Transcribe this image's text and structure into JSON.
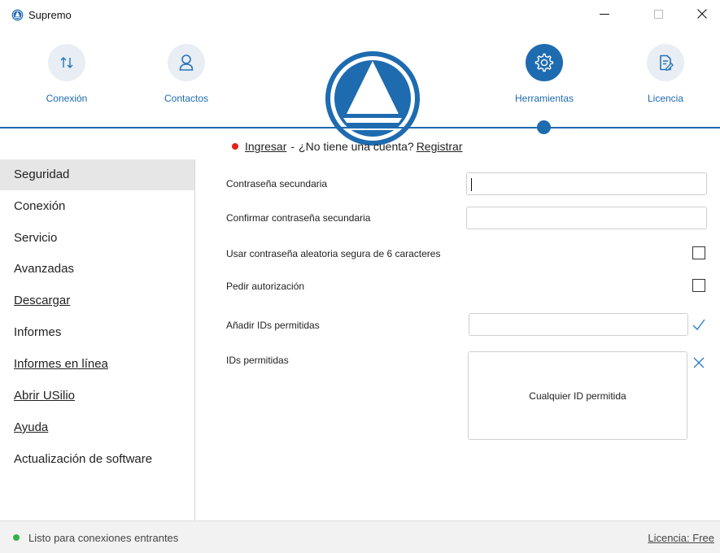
{
  "window": {
    "title": "Supremo",
    "controls": [
      "minimize",
      "maximize",
      "close"
    ]
  },
  "nav": {
    "items": [
      {
        "label": "Conexión",
        "icon": "transfer-arrows-icon",
        "active": false
      },
      {
        "label": "Contactos",
        "icon": "user-icon",
        "active": false
      },
      {
        "label": "Herramientas",
        "icon": "gear-icon",
        "active": true
      },
      {
        "label": "Licencia",
        "icon": "document-edit-icon",
        "active": false
      }
    ],
    "logo": "supremo-logo",
    "accent_color": "#1e6bb0"
  },
  "login": {
    "login_link": "Ingresar",
    "separator": "-",
    "question": "¿No tiene una cuenta?",
    "register_link": "Registrar",
    "status_color": "#e5201b"
  },
  "sidebar": {
    "items": [
      {
        "label": "Seguridad",
        "selected": true
      },
      {
        "label": "Conexión"
      },
      {
        "label": "Servicio"
      },
      {
        "label": "Avanzadas"
      },
      {
        "label": "Descargar",
        "link": true
      },
      {
        "label": "Informes"
      },
      {
        "label": "Informes en línea",
        "link": true
      },
      {
        "label": "Abrir USilio",
        "link": true
      },
      {
        "label": "Ayuda",
        "link": true
      },
      {
        "label": "Actualización de software"
      }
    ]
  },
  "security": {
    "secondary_password_label": "Contraseña secundaria",
    "secondary_password_value": "",
    "confirm_password_label": "Confirmar contraseña secundaria",
    "confirm_password_value": "",
    "random_password_label": "Usar contraseña aleatoria segura de 6 caracteres",
    "random_password_checked": false,
    "ask_authorization_label": "Pedir autorización",
    "ask_authorization_checked": false,
    "add_ids_label": "Añadir IDs permitidas",
    "add_ids_value": "",
    "allowed_ids_label": "IDs permitidas",
    "allowed_ids_empty_text": "Cualquier ID permitida"
  },
  "statusbar": {
    "status_text": "Listo para conexiones entrantes",
    "status_color": "#33b14a",
    "license_text": "Licencia: Free"
  }
}
